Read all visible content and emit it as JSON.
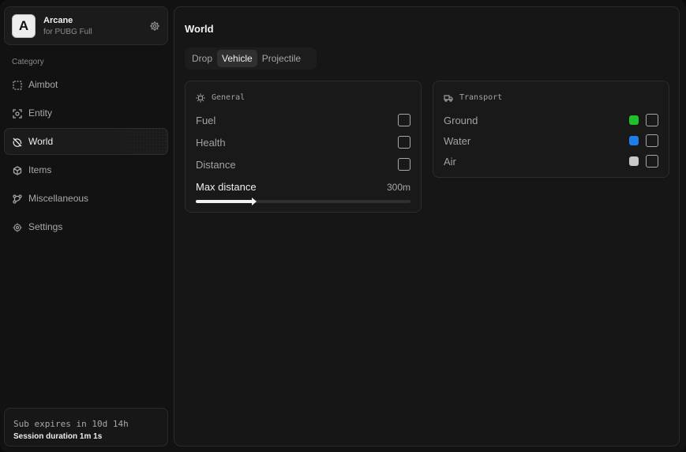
{
  "app": {
    "logo_letter": "A",
    "name": "Arcane",
    "subtitle": "for PUBG Full"
  },
  "sidebar": {
    "category_label": "Category",
    "items": [
      {
        "label": "Aimbot",
        "icon": "crosshair-dashed-icon"
      },
      {
        "label": "Entity",
        "icon": "scan-icon"
      },
      {
        "label": "World",
        "icon": "globe-off-icon",
        "active": true
      },
      {
        "label": "Items",
        "icon": "box-icon"
      },
      {
        "label": "Miscellaneous",
        "icon": "git-graph-icon"
      },
      {
        "label": "Settings",
        "icon": "gear-icon"
      }
    ]
  },
  "subscription": {
    "expires_text": "Sub expires in 10d 14h",
    "session_text": "Session duration  1m  1s"
  },
  "main": {
    "title": "World",
    "tabs": [
      {
        "label": "Drop"
      },
      {
        "label": "Vehicle",
        "active": true
      },
      {
        "label": "Projectile"
      }
    ]
  },
  "general": {
    "header": "General",
    "rows": [
      {
        "label": "Fuel",
        "checked": false
      },
      {
        "label": "Health",
        "checked": false
      },
      {
        "label": "Distance",
        "checked": false
      }
    ],
    "slider": {
      "label": "Max distance",
      "value_text": "300m",
      "fraction": 0.27
    }
  },
  "transport": {
    "header": "Transport",
    "rows": [
      {
        "label": "Ground",
        "color": "#1fc12a",
        "checked": false
      },
      {
        "label": "Water",
        "color": "#1e7ee8",
        "checked": false
      },
      {
        "label": "Air",
        "color": "#c8c8c8",
        "checked": false
      }
    ]
  },
  "colors": {
    "background": "#111211",
    "panel": "#181918",
    "accent_text": "#f0f0f0"
  }
}
